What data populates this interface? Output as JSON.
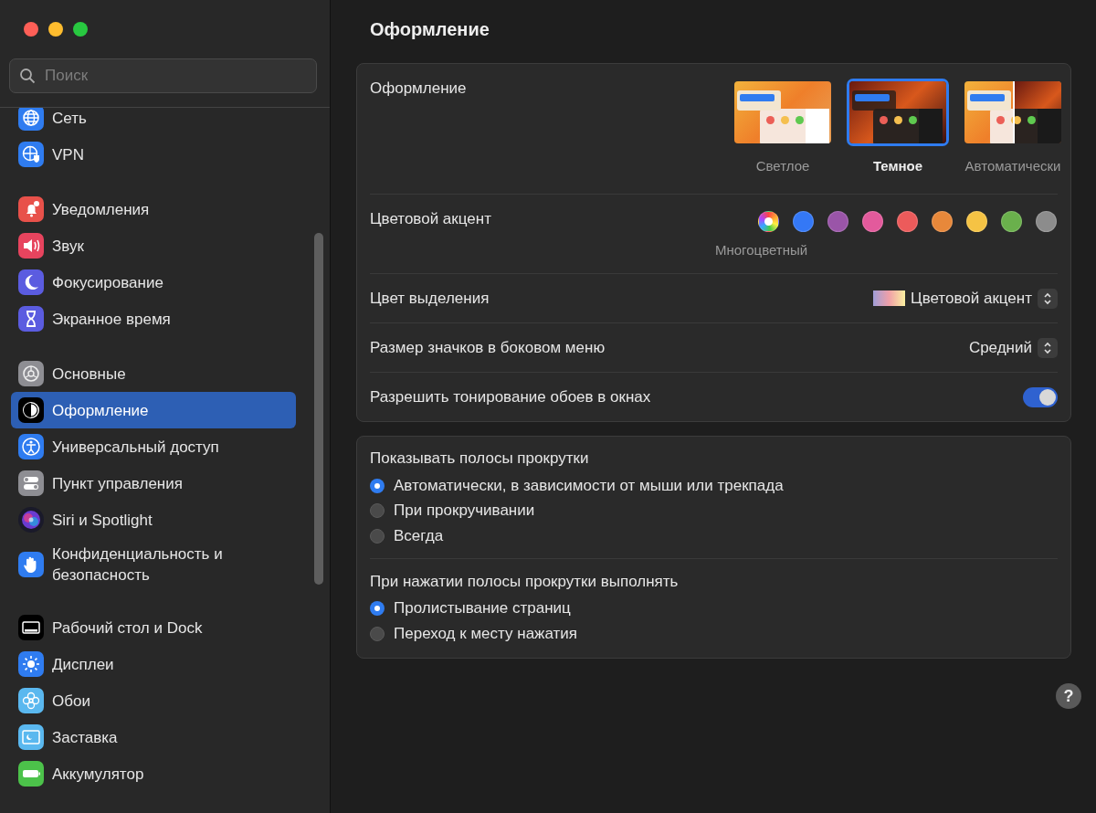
{
  "sidebar": {
    "search": {
      "placeholder": "Поиск"
    },
    "groups": [
      [
        {
          "label": "Сеть",
          "selected": false
        },
        {
          "label": "VPN",
          "selected": false
        }
      ],
      [
        {
          "label": "Уведомления",
          "selected": false
        },
        {
          "label": "Звук",
          "selected": false
        },
        {
          "label": "Фокусирование",
          "selected": false
        },
        {
          "label": "Экранное время",
          "selected": false
        }
      ],
      [
        {
          "label": "Основные",
          "selected": false
        },
        {
          "label": "Оформление",
          "selected": true
        },
        {
          "label": "Универсальный доступ",
          "selected": false
        },
        {
          "label": "Пункт управления",
          "selected": false
        },
        {
          "label": "Siri и Spotlight",
          "selected": false
        },
        {
          "label": "Конфиденциальность и безопасность",
          "selected": false
        }
      ],
      [
        {
          "label": "Рабочий стол и Dock",
          "selected": false
        },
        {
          "label": "Дисплеи",
          "selected": false
        },
        {
          "label": "Обои",
          "selected": false
        },
        {
          "label": "Заставка",
          "selected": false
        },
        {
          "label": "Аккумулятор",
          "selected": false
        }
      ]
    ]
  },
  "main": {
    "title": "Оформление",
    "appearance": {
      "label": "Оформление",
      "options": [
        {
          "kind": "light",
          "label": "Светлое",
          "selected": false
        },
        {
          "kind": "dark",
          "label": "Темное",
          "selected": true
        },
        {
          "kind": "auto",
          "label": "Автоматически",
          "selected": false
        }
      ]
    },
    "accent": {
      "label": "Цветовой акцент",
      "caption": "Многоцветный",
      "colors": [
        {
          "kind": "multicolor",
          "selected": true
        },
        {
          "kind": "solid",
          "color": "#3478f6",
          "selected": false
        },
        {
          "kind": "solid",
          "color": "#9a55a8",
          "selected": false
        },
        {
          "kind": "solid",
          "color": "#e35a9c",
          "selected": false
        },
        {
          "kind": "solid",
          "color": "#ec5b5b",
          "selected": false
        },
        {
          "kind": "solid",
          "color": "#e8883a",
          "selected": false
        },
        {
          "kind": "solid",
          "color": "#f5c344",
          "selected": false
        },
        {
          "kind": "solid",
          "color": "#6ab04c",
          "selected": false
        },
        {
          "kind": "solid",
          "color": "#8c8c8c",
          "selected": false
        }
      ]
    },
    "highlight": {
      "label": "Цвет выделения",
      "value": "Цветовой акцент"
    },
    "icon_size": {
      "label": "Размер значков в боковом меню",
      "value": "Средний"
    },
    "tinting": {
      "label": "Разрешить тонирование обоев в окнах",
      "on": true
    },
    "scroll_groups": [
      {
        "title": "Показывать полосы прокрутки",
        "options": [
          {
            "label": "Автоматически, в зависимости от мыши или трекпада",
            "selected": true
          },
          {
            "label": "При прокручивании",
            "selected": false
          },
          {
            "label": "Всегда",
            "selected": false
          }
        ]
      },
      {
        "title": "При нажатии полосы прокрутки выполнять",
        "options": [
          {
            "label": "Пролистывание страниц",
            "selected": true
          },
          {
            "label": "Переход к месту нажатия",
            "selected": false
          }
        ]
      }
    ],
    "help": "?"
  }
}
